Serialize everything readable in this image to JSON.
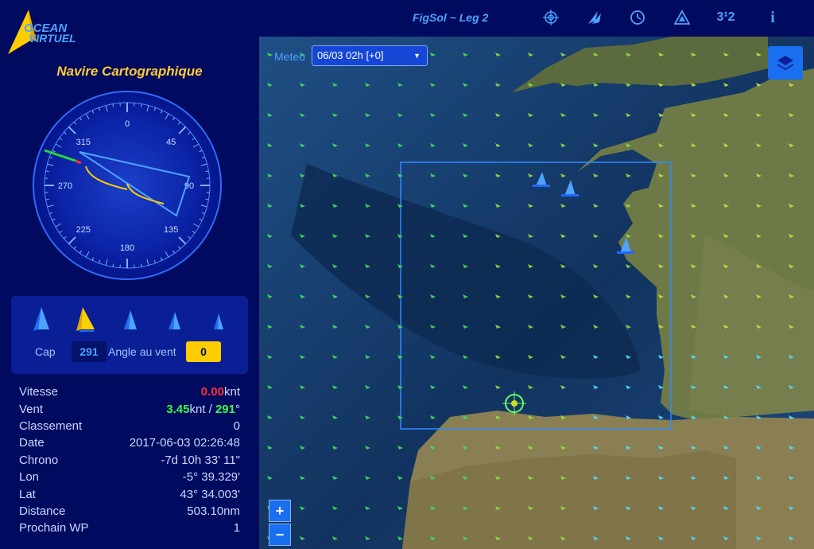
{
  "header": {
    "logo_text": "OCEAN VIRTUEL",
    "leg_title": "FigSol ~ Leg 2",
    "icons": [
      "target-icon",
      "sail-settings-icon",
      "clock-icon",
      "warning-icon",
      "ranking-icon",
      "info-icon"
    ],
    "ranking_icon_text": "3¹2",
    "info_icon_text": "i"
  },
  "panel": {
    "title": "Navire Cartographique",
    "compass": {
      "labels": [
        "0",
        "45",
        "90",
        "135",
        "180",
        "225",
        "270",
        "315"
      ],
      "heading_deg": 291
    },
    "sails": {
      "items": [
        "jib-sail",
        "spinnaker-sail",
        "staysail",
        "light-jib",
        "code0-sail"
      ],
      "selected_index": 1,
      "cap_label": "Cap",
      "cap_value": "291",
      "angle_label": "Angle au vent",
      "angle_value": "0"
    },
    "stats": {
      "vitesse_label": "Vitesse",
      "vitesse_value": "0.00",
      "vitesse_unit": "knt",
      "vent_label": "Vent",
      "vent_speed": "3.45",
      "vent_mid": "knt / ",
      "vent_dir": "291",
      "vent_deg": "°",
      "classement_label": "Classement",
      "classement_value": "0",
      "date_label": "Date",
      "date_value": "2017-06-03 02:26:48",
      "chrono_label": "Chrono",
      "chrono_value": "-7d 10h 33' 11\"",
      "lon_label": "Lon",
      "lon_value": "-5° 39.329'",
      "lat_label": "Lat",
      "lat_value": "43° 34.003'",
      "distance_label": "Distance",
      "distance_value": "503.10nm",
      "wp_label": "Prochain WP",
      "wp_value": "1"
    }
  },
  "map": {
    "meteo_label": "Meteo",
    "meteo_selected": "06/03 02h [+0]",
    "zoom_in": "+",
    "zoom_out": "−"
  },
  "colors": {
    "background": "#000a5e",
    "accent": "#4da3ff",
    "title": "#ffcc33",
    "speed_zero": "#ff3030",
    "wind_green": "#33ff44"
  }
}
